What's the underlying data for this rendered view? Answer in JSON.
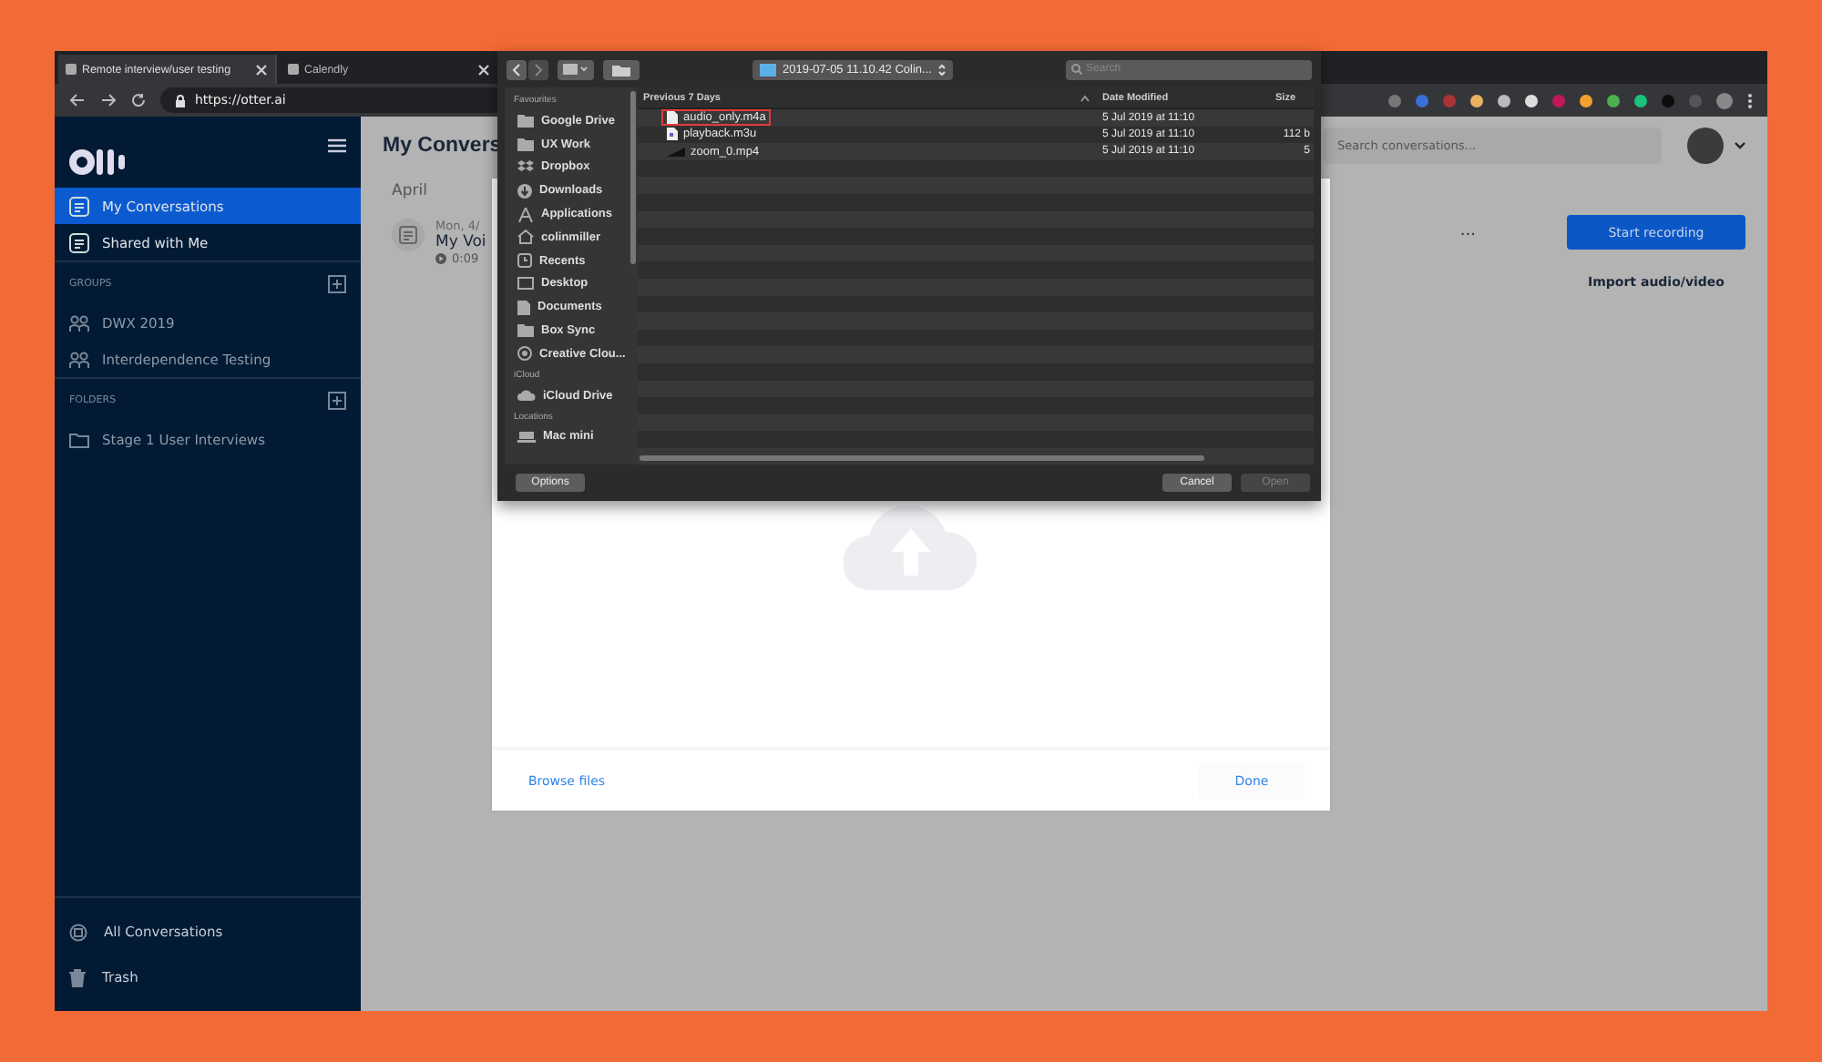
{
  "browser": {
    "tabs": [
      {
        "title": "Remote interview/user testing",
        "selected": true
      },
      {
        "title": "Calendly",
        "selected": false
      }
    ],
    "url": "https://otter.ai"
  },
  "sidebar": {
    "nav": [
      {
        "label": "My Conversations",
        "selected": true
      },
      {
        "label": "Shared with Me",
        "selected": false
      }
    ],
    "groups_heading": "GROUPS",
    "groups": [
      "DWX 2019",
      "Interdependence Testing"
    ],
    "folders_heading": "FOLDERS",
    "folders": [
      "Stage 1 User Interviews"
    ],
    "footer": [
      {
        "label": "All Conversations",
        "kind": "all"
      },
      {
        "label": "Trash",
        "kind": "trash"
      }
    ]
  },
  "main": {
    "title": "My Convers",
    "month": "April",
    "conversation": {
      "date": "Mon, 4/",
      "title": "My Voi",
      "duration": "0:09"
    },
    "search": {
      "placeholder": "Search conversations..."
    },
    "more": "...",
    "start_button": "Start recording",
    "import_link": "Import audio/video"
  },
  "upload_modal": {
    "browse": "Browse files",
    "done": "Done"
  },
  "file_dialog": {
    "folder": "2019-07-05 11.10.42 Colin...",
    "search_placeholder": "Search",
    "sections": [
      {
        "heading": "Favourites",
        "items": [
          {
            "label": "Google Drive",
            "kind": "folder"
          },
          {
            "label": "UX Work",
            "kind": "folder"
          },
          {
            "label": "Dropbox",
            "kind": "dropbox"
          },
          {
            "label": "Downloads",
            "kind": "download"
          },
          {
            "label": "Applications",
            "kind": "apps"
          },
          {
            "label": "colinmiller",
            "kind": "home"
          },
          {
            "label": "Recents",
            "kind": "recents"
          },
          {
            "label": "Desktop",
            "kind": "desktop"
          },
          {
            "label": "Documents",
            "kind": "document"
          },
          {
            "label": "Box Sync",
            "kind": "folder"
          },
          {
            "label": "Creative Clou...",
            "kind": "creative"
          }
        ]
      },
      {
        "heading": "iCloud",
        "items": [
          {
            "label": "iCloud Drive",
            "kind": "cloud"
          }
        ]
      },
      {
        "heading": "Locations",
        "items": [
          {
            "label": "Mac mini",
            "kind": "computer"
          }
        ]
      }
    ],
    "columns": [
      "Previous 7 Days",
      "Date Modified",
      "Size"
    ],
    "files": [
      {
        "name": "audio_only.m4a",
        "modified": "5 Jul 2019 at 11:10",
        "highlighted": true,
        "kind": "audio"
      },
      {
        "name": "playback.m3u",
        "modified": "5 Jul 2019 at 11:10",
        "size": "112 b",
        "highlighted": false,
        "kind": "playlist"
      },
      {
        "name": "zoom_0.mp4",
        "modified": "5 Jul 2019 at 11:10",
        "size": "5",
        "highlighted": false,
        "kind": "video"
      }
    ],
    "options_button": "Options",
    "cancel_button": {
      "label": "Cancel",
      "disabled": false
    },
    "open_button": {
      "label": "Open",
      "disabled": true
    }
  }
}
